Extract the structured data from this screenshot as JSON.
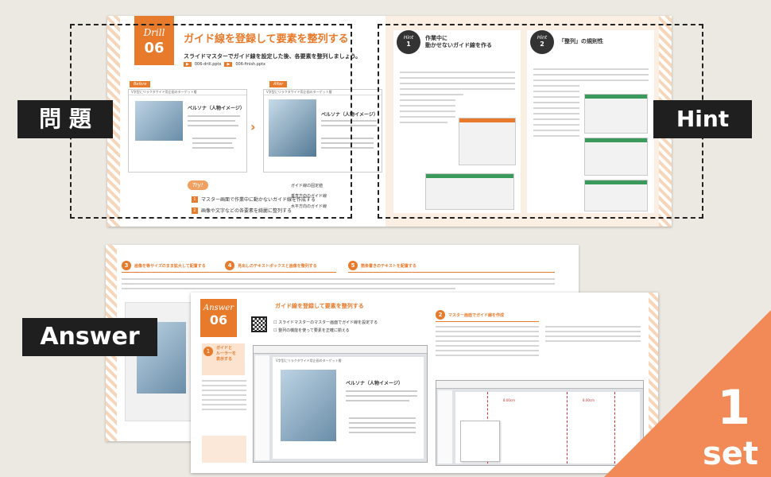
{
  "top_spread": {
    "drill_word": "Drill",
    "drill_number": "06",
    "title": "ガイド線を登録して要素を整列する",
    "subtitle": "スライドマスターでガイド線を設定した後、各要素を整列しましょう。",
    "file_tags": [
      "006-drill.pptx",
      "006-finish.pptx"
    ],
    "before_label": "Before",
    "after_label": "After",
    "slide_header": "V字型にリラクタワイド用企画のターゲット層",
    "persona_title": "ペルソナ（人物イメージ）",
    "try_label": "Try!",
    "tasks": [
      "マスター画面で作業中に動かないガイド線を作成する",
      "画像や文字などの各要素を綺麗に整列する"
    ],
    "guide_rows": [
      "ガイド線の固定値",
      "垂直方向のガイド線",
      "水平方向のガイド線"
    ],
    "hint1": {
      "word": "Hint",
      "num": "1",
      "title_l1": "作業中に",
      "title_l2": "動かせないガイド線を作る"
    },
    "hint2": {
      "word": "Hint",
      "num": "2",
      "title": "「整列」の規則性"
    }
  },
  "labels": {
    "mondai": "問 題",
    "hint": "Hint",
    "answer": "Answer"
  },
  "mid_spread": {
    "sections": [
      {
        "num": "3",
        "title": "画像を等サイズのまま拡大して配置する"
      },
      {
        "num": "4",
        "title": "見出しのテキストボックスと画像を整列する"
      },
      {
        "num": "5",
        "title": "箇条書きのテキストを配置する"
      }
    ]
  },
  "front_spread": {
    "answer_word": "Answer",
    "answer_number": "06",
    "title": "ガイド線を登録して要素を整列する",
    "tasks": [
      "スライドマスターのマスター画面でガイド線を設定する",
      "整列の機能を使って要素を正確に揃える"
    ],
    "step1": {
      "num": "1",
      "title_l1": "ガイドと",
      "title_l2": "ルーラーを",
      "title_l3": "表示する"
    },
    "step2": {
      "num": "2",
      "title": "マスター画面でガイド線を作成"
    },
    "persona_title": "ペルソナ（人物イメージ）",
    "guide_values": [
      "8.00cm",
      "8.00cm"
    ]
  },
  "corner": {
    "number": "1",
    "word": "set"
  },
  "colors": {
    "accent": "#e87a2b",
    "corner": "#f28a57",
    "label_bg": "#1f1f1f"
  }
}
